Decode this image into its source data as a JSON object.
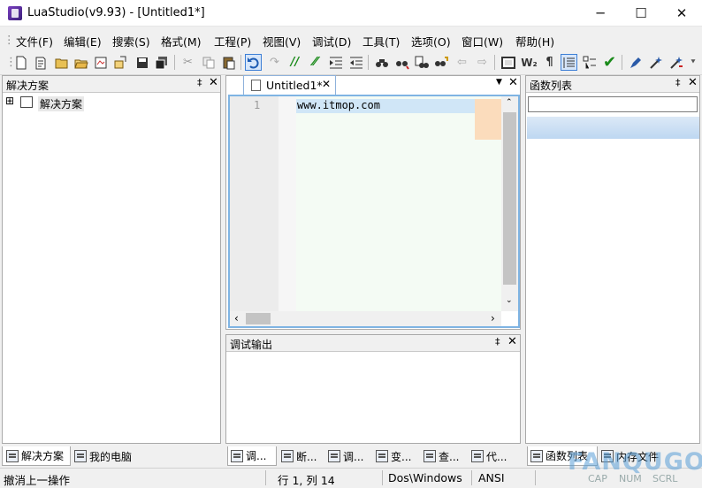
{
  "window": {
    "title": "LuaStudio(v9.93) - [Untitled1*]",
    "minimize": "─",
    "maximize": "☐",
    "close": "✕"
  },
  "menu": [
    "文件(F)",
    "编辑(E)",
    "搜索(S)",
    "格式(M)",
    "工程(P)",
    "视图(V)",
    "调试(D)",
    "工具(T)",
    "选项(O)",
    "窗口(W)",
    "帮助(H)"
  ],
  "toolbar": {
    "icons": [
      "new-file-icon",
      "new-doc-icon",
      "open-folder-icon",
      "open-icon",
      "open-project-icon",
      "import-icon",
      "save-icon",
      "save-all-icon",
      "cut-icon",
      "copy-icon",
      "paste-icon",
      "undo-icon",
      "redo-icon",
      "comment-icon",
      "uncomment-icon",
      "indent-icon",
      "outdent-icon",
      "find-icon",
      "find-next-icon",
      "find-in-files-icon",
      "replace-icon",
      "go-back-icon",
      "go-forward-icon",
      "fullscreen-icon",
      "word-wrap-icon",
      "pilcrow-icon",
      "line-numbers-icon",
      "fold-icon",
      "check-icon",
      "pen-icon",
      "magic-icon",
      "magic-next-icon"
    ]
  },
  "left_panel": {
    "title": "解决方案",
    "pin": "‡",
    "close": "✕",
    "tree_expander": "⊞",
    "tree_root": "解决方案"
  },
  "editor": {
    "tab_label": "Untitled1*",
    "tab_close": "✕",
    "tab_dropdown": "▼",
    "tab_area_close": "✕",
    "line_number": "1",
    "code": "www.itmop.com"
  },
  "right_panel": {
    "title": "函数列表",
    "pin": "‡",
    "close": "✕",
    "search_value": ""
  },
  "debug_panel": {
    "title": "调试输出",
    "pin": "‡",
    "close": "✕"
  },
  "bottom_tabs_left": [
    "解决方案",
    "我的电脑"
  ],
  "bottom_tabs_center": [
    "调...",
    "断...",
    "调...",
    "变...",
    "查...",
    "代..."
  ],
  "bottom_tabs_right": [
    "函数列表",
    "内存文件"
  ],
  "status": {
    "message": "撤消上一操作",
    "position": "行 1, 列 14",
    "line_ending": "Dos\\Windows",
    "encoding": "ANSI",
    "cap": "CAP",
    "num": "NUM",
    "scrl": "SCRL"
  },
  "watermark": "FANQUGO",
  "colors": {
    "editor_frame": "#7fb4e3",
    "line_highlight": "#d0e6f7",
    "code_bg": "#f4fbf4"
  }
}
